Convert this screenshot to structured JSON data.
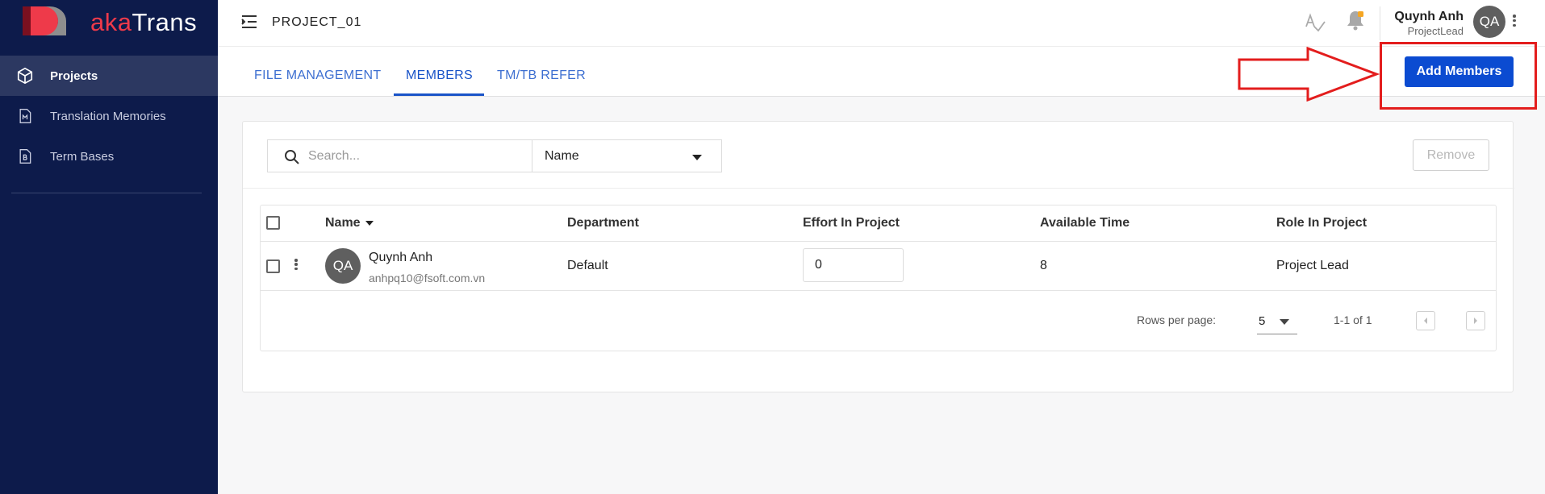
{
  "brand": {
    "prefix": "aka",
    "suffix": "Trans",
    "accent": "#ee3a4a",
    "sidebar_bg": "#0d1b4b"
  },
  "sidebar": {
    "items": [
      {
        "label": "Projects",
        "icon": "box-icon",
        "active": true
      },
      {
        "label": "Translation Memories",
        "icon": "memory-doc-icon",
        "active": false
      },
      {
        "label": "Term Bases",
        "icon": "termbase-doc-icon",
        "active": false
      }
    ]
  },
  "header": {
    "project_title": "PROJECT_01",
    "user": {
      "name": "Quynh Anh",
      "role": "ProjectLead",
      "initials": "QA"
    }
  },
  "tabs": [
    {
      "label": "FILE MANAGEMENT",
      "active": false
    },
    {
      "label": "MEMBERS",
      "active": true
    },
    {
      "label": "TM/TB REFER",
      "active": false
    }
  ],
  "actions": {
    "add_members_label": "Add Members",
    "remove_label": "Remove",
    "primary_color": "#0b4bd1"
  },
  "filters": {
    "search_placeholder": "Search...",
    "field_selected": "Name"
  },
  "table": {
    "columns": [
      "Name",
      "Department",
      "Effort In Project",
      "Available Time",
      "Role In Project"
    ],
    "rows": [
      {
        "initials": "QA",
        "name": "Quynh Anh",
        "email": "anhpq10@fsoft.com.vn",
        "department": "Default",
        "effort": "0",
        "available_time": "8",
        "role": "Project Lead"
      }
    ]
  },
  "pagination": {
    "rows_per_page_label": "Rows per page:",
    "rows_per_page": "5",
    "range": "1-1 of 1"
  }
}
